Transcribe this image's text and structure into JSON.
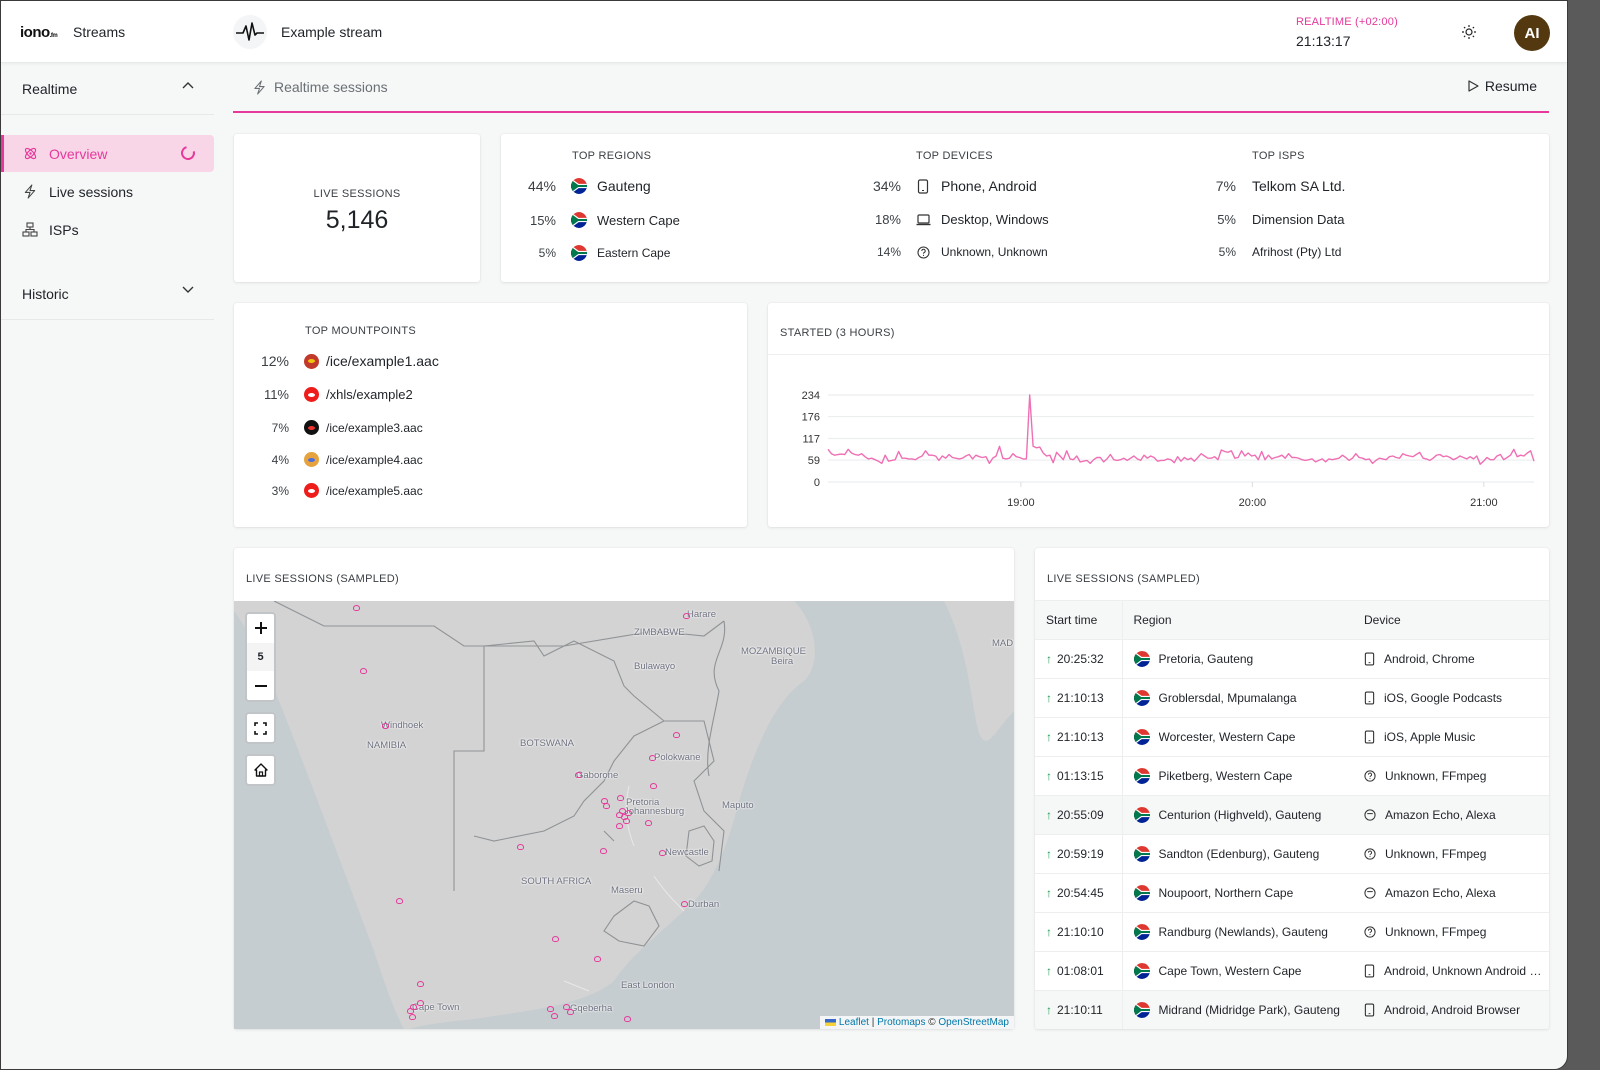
{
  "header": {
    "logo_text": "iono",
    "logo_suffix": ".fm",
    "app_name": "Streams",
    "stream_name": "Example stream",
    "realtime_label": "REALTIME (+02:00)",
    "realtime_time": "21:13:17",
    "avatar_initials": "AI",
    "accent_color": "#e6399b"
  },
  "sidebar": {
    "realtime_section": "Realtime",
    "historic_section": "Historic",
    "items": [
      {
        "label": "Overview",
        "icon": "atom-icon",
        "active": true
      },
      {
        "label": "Live sessions",
        "icon": "lightning-icon",
        "active": false
      },
      {
        "label": "ISPs",
        "icon": "network-icon",
        "active": false
      }
    ]
  },
  "subbar": {
    "title": "Realtime sessions",
    "resume_label": "Resume"
  },
  "live_sessions": {
    "caption": "LIVE SESSIONS",
    "value": "5,146"
  },
  "top_regions": {
    "caption": "TOP REGIONS",
    "rows": [
      {
        "pct": "44%",
        "name": "Gauteng"
      },
      {
        "pct": "15%",
        "name": "Western Cape"
      },
      {
        "pct": "5%",
        "name": "Eastern Cape"
      }
    ]
  },
  "top_devices": {
    "caption": "TOP DEVICES",
    "rows": [
      {
        "pct": "34%",
        "name": "Phone, Android",
        "icon": "phone-icon"
      },
      {
        "pct": "18%",
        "name": "Desktop, Windows",
        "icon": "laptop-icon"
      },
      {
        "pct": "14%",
        "name": "Unknown, Unknown",
        "icon": "question-icon"
      }
    ]
  },
  "top_isps": {
    "caption": "TOP ISPS",
    "rows": [
      {
        "pct": "7%",
        "name": "Telkom SA Ltd."
      },
      {
        "pct": "5%",
        "name": "Dimension Data"
      },
      {
        "pct": "5%",
        "name": "Afrihost (Pty) Ltd"
      }
    ]
  },
  "top_mountpoints": {
    "caption": "TOP MOUNTPOINTS",
    "rows": [
      {
        "pct": "12%",
        "name": "/ice/example1.aac"
      },
      {
        "pct": "11%",
        "name": "/xhls/example2"
      },
      {
        "pct": "7%",
        "name": "/ice/example3.aac"
      },
      {
        "pct": "4%",
        "name": "/ice/example4.aac"
      },
      {
        "pct": "3%",
        "name": "/ice/example5.aac"
      }
    ]
  },
  "chart_data": {
    "type": "line",
    "title": "STARTED (3 HOURS)",
    "xlabel": "",
    "ylabel": "",
    "yticks": [
      0,
      59,
      117,
      176,
      234
    ],
    "ylim": [
      0,
      234
    ],
    "xticks": [
      "19:00",
      "20:00",
      "21:00"
    ],
    "x_range": [
      "18:10",
      "21:13"
    ],
    "grid": true,
    "series": [
      {
        "name": "started",
        "color": "#ef6fb4",
        "values": [
          88,
          76,
          72,
          74,
          75,
          74,
          88,
          78,
          74,
          72,
          76,
          68,
          62,
          64,
          60,
          56,
          50,
          72,
          56,
          58,
          60,
          82,
          64,
          64,
          62,
          62,
          60,
          66,
          70,
          84,
          72,
          72,
          70,
          58,
          70,
          64,
          74,
          66,
          64,
          62,
          64,
          70,
          74,
          62,
          72,
          68,
          66,
          68,
          50,
          64,
          70,
          96,
          64,
          62,
          64,
          76,
          68,
          66,
          62,
          62,
          234,
          96,
          92,
          94,
          78,
          70,
          72,
          52,
          80,
          70,
          60,
          84,
          62,
          60,
          70,
          54,
          56,
          58,
          50,
          60,
          66,
          66,
          54,
          62,
          74,
          60,
          58,
          60,
          64,
          58,
          64,
          70,
          62,
          58,
          72,
          64,
          70,
          66,
          56,
          58,
          58,
          62,
          60,
          52,
          68,
          56,
          66,
          60,
          64,
          56,
          66,
          76,
          70,
          64,
          64,
          68,
          60,
          86,
          82,
          80,
          84,
          64,
          66,
          84,
          70,
          78,
          70,
          72,
          60,
          82,
          60,
          72,
          62,
          66,
          68,
          72,
          64,
          76,
          66,
          66,
          64,
          60,
          58,
          60,
          62,
          54,
          58,
          62,
          54,
          62,
          60,
          62,
          64,
          72,
          66,
          58,
          64,
          76,
          66,
          64,
          60,
          62,
          50,
          58,
          64,
          62,
          60,
          68,
          70,
          66,
          64,
          76,
          72,
          70,
          68,
          74,
          80,
          64,
          62,
          58,
          64,
          72,
          74,
          68,
          70,
          66,
          60,
          64,
          70,
          66,
          62,
          68,
          62,
          70,
          48,
          56,
          66,
          60,
          60,
          70,
          74,
          60,
          66,
          72,
          88,
          68,
          72,
          70,
          78,
          84,
          56
        ]
      }
    ]
  },
  "map": {
    "caption": "LIVE SESSIONS (SAMPLED)",
    "zoom_level": "5",
    "attribution": {
      "leaflet": "Leaflet",
      "sep": "|",
      "protomaps": "Protomaps",
      "copy": "©",
      "osm": "OpenStreetMap"
    },
    "labels": [
      "Harare",
      "ZIMBABWE",
      "Bulawayo",
      "MOZAMBIQUE",
      "Beira",
      "MAD",
      "Windhoek",
      "NAMIBIA",
      "BOTSWANA",
      "Polokwane",
      "Gaborone",
      "Pretoria",
      "Johannesburg",
      "Maputo",
      "Newcastle",
      "SOUTH AFRICA",
      "Maseru",
      "Durban",
      "East London",
      "Cape Town",
      "Gqeberha"
    ]
  },
  "sessions_table": {
    "caption": "LIVE SESSIONS (SAMPLED)",
    "columns": [
      "Start time",
      "Region",
      "Device"
    ],
    "rows": [
      {
        "time": "20:25:32",
        "region": "Pretoria, Gauteng",
        "device": "Android, Chrome",
        "icon": "phone-icon"
      },
      {
        "time": "21:10:13",
        "region": "Groblersdal, Mpumalanga",
        "device": "iOS, Google Podcasts",
        "icon": "phone-icon"
      },
      {
        "time": "21:10:13",
        "region": "Worcester, Western Cape",
        "device": "iOS, Apple Music",
        "icon": "phone-icon"
      },
      {
        "time": "01:13:15",
        "region": "Piketberg, Western Cape",
        "device": "Unknown, FFmpeg",
        "icon": "question-icon"
      },
      {
        "time": "20:55:09",
        "region": "Centurion (Highveld), Gauteng",
        "device": "Amazon Echo, Alexa",
        "icon": "speaker-icon"
      },
      {
        "time": "20:59:19",
        "region": "Sandton (Edenburg), Gauteng",
        "device": "Unknown, FFmpeg",
        "icon": "question-icon"
      },
      {
        "time": "20:54:45",
        "region": "Noupoort, Northern Cape",
        "device": "Amazon Echo, Alexa",
        "icon": "speaker-icon"
      },
      {
        "time": "21:10:10",
        "region": "Randburg (Newlands), Gauteng",
        "device": "Unknown, FFmpeg",
        "icon": "question-icon"
      },
      {
        "time": "01:08:01",
        "region": "Cape Town, Western Cape",
        "device": "Android, Unknown Android Browser",
        "icon": "phone-icon"
      },
      {
        "time": "21:10:11",
        "region": "Midrand (Midridge Park), Gauteng",
        "device": "Android, Android Browser",
        "icon": "phone-icon"
      }
    ]
  }
}
